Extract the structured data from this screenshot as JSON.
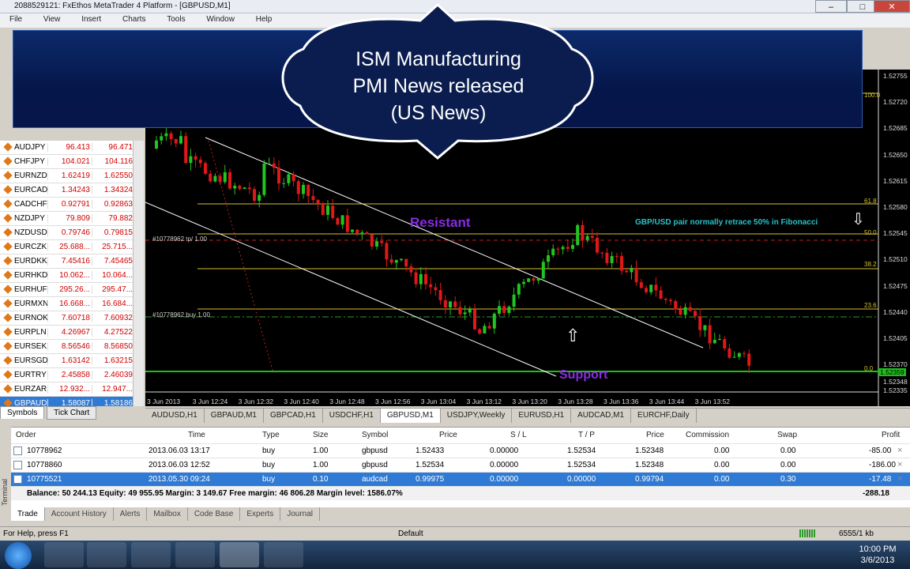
{
  "window": {
    "title": "2088529121: FxEthos MetaTrader 4 Platform - [GBPUSD,M1]"
  },
  "menu": [
    "File",
    "View",
    "Insert",
    "Charts",
    "Tools",
    "Window",
    "Help"
  ],
  "banner": {
    "line1": "ISM Manufacturing",
    "line2": "PMI News released",
    "line3": "(US News)"
  },
  "market_watch": {
    "rows": [
      {
        "symbol": "AUDJPY",
        "bid": "96.413",
        "ask": "96.471"
      },
      {
        "symbol": "CHFJPY",
        "bid": "104.021",
        "ask": "104.116"
      },
      {
        "symbol": "EURNZD",
        "bid": "1.62419",
        "ask": "1.62550"
      },
      {
        "symbol": "EURCAD",
        "bid": "1.34243",
        "ask": "1.34324"
      },
      {
        "symbol": "CADCHF",
        "bid": "0.92791",
        "ask": "0.92863"
      },
      {
        "symbol": "NZDJPY",
        "bid": "79.809",
        "ask": "79.882"
      },
      {
        "symbol": "NZDUSD",
        "bid": "0.79746",
        "ask": "0.79815"
      },
      {
        "symbol": "EURCZK",
        "bid": "25.688...",
        "ask": "25.715..."
      },
      {
        "symbol": "EURDKK",
        "bid": "7.45416",
        "ask": "7.45465"
      },
      {
        "symbol": "EURHKD",
        "bid": "10.062...",
        "ask": "10.064..."
      },
      {
        "symbol": "EURHUF",
        "bid": "295.26...",
        "ask": "295.47..."
      },
      {
        "symbol": "EURMXN",
        "bid": "16.668...",
        "ask": "16.684..."
      },
      {
        "symbol": "EURNOK",
        "bid": "7.60718",
        "ask": "7.60932"
      },
      {
        "symbol": "EURPLN",
        "bid": "4.26967",
        "ask": "4.27522"
      },
      {
        "symbol": "EURSEK",
        "bid": "8.56546",
        "ask": "8.56850"
      },
      {
        "symbol": "EURSGD",
        "bid": "1.63142",
        "ask": "1.63215"
      },
      {
        "symbol": "EURTRY",
        "bid": "2.45858",
        "ask": "2.46039"
      },
      {
        "symbol": "EURZAR",
        "bid": "12.932...",
        "ask": "12.947..."
      },
      {
        "symbol": "GBPAUD",
        "bid": "1.58087",
        "ask": "1.58186"
      }
    ],
    "tabs": [
      "Symbols",
      "Tick Chart"
    ]
  },
  "chart": {
    "resistant_label": "Resistant",
    "support_label": "Support",
    "fib_note": "GBP/USD pair normally retrace 50% in Fibonacci",
    "tp_label": "#10778962 tp/ 1.00",
    "buy_label": "#10778962 buy 1.00",
    "fib_levels": [
      "100.0",
      "61.8",
      "50.0",
      "38.2",
      "23.6",
      "0.0"
    ],
    "price_axis": [
      "1.52755",
      "1.52720",
      "1.52685",
      "1.52650",
      "1.52615",
      "1.52580",
      "1.52545",
      "1.52510",
      "1.52475",
      "1.52440",
      "1.52405",
      "1.52370",
      "1.52335"
    ],
    "current_price": "1.52359",
    "last_price": "1.52348",
    "time_axis": [
      "3 Jun 2013",
      "3 Jun 12:24",
      "3 Jun 12:32",
      "3 Jun 12:40",
      "3 Jun 12:48",
      "3 Jun 12:56",
      "3 Jun 13:04",
      "3 Jun 13:12",
      "3 Jun 13:20",
      "3 Jun 13:28",
      "3 Jun 13:36",
      "3 Jun 13:44",
      "3 Jun 13:52"
    ],
    "colors": {
      "bull": "#21c521",
      "bear": "#e01818",
      "channel": "#ffffff",
      "fib": "#d6c12f",
      "support": "#1dbf1d"
    }
  },
  "chart_tabs": [
    "AUDUSD,H1",
    "GBPAUD,M1",
    "GBPCAD,H1",
    "USDCHF,H1",
    "GBPUSD,M1",
    "USDJPY,Weekly",
    "EURUSD,H1",
    "AUDCAD,M1",
    "EURCHF,Daily"
  ],
  "chart_tab_active": "GBPUSD,M1",
  "terminal": {
    "headers": [
      "Order",
      "Time",
      "Type",
      "Size",
      "Symbol",
      "Price",
      "S / L",
      "T / P",
      "Price",
      "Commission",
      "Swap",
      "Profit"
    ],
    "rows": [
      {
        "order": "10778962",
        "time": "2013.06.03 13:17",
        "type": "buy",
        "size": "1.00",
        "symbol": "gbpusd",
        "price": "1.52433",
        "sl": "0.00000",
        "tp": "1.52534",
        "cur": "1.52348",
        "comm": "0.00",
        "swap": "0.00",
        "profit": "-85.00"
      },
      {
        "order": "10778860",
        "time": "2013.06.03 12:52",
        "type": "buy",
        "size": "1.00",
        "symbol": "gbpusd",
        "price": "1.52534",
        "sl": "0.00000",
        "tp": "1.52534",
        "cur": "1.52348",
        "comm": "0.00",
        "swap": "0.00",
        "profit": "-186.00"
      },
      {
        "order": "10775521",
        "time": "2013.05.30 09:24",
        "type": "buy",
        "size": "0.10",
        "symbol": "audcad",
        "price": "0.99975",
        "sl": "0.00000",
        "tp": "0.00000",
        "cur": "0.99794",
        "comm": "0.00",
        "swap": "0.30",
        "profit": "-17.48"
      }
    ],
    "balance_line": "Balance: 50 244.13  Equity: 49 955.95  Margin: 3 149.67  Free margin: 46 806.28  Margin level: 1586.07%",
    "total_profit": "-288.18",
    "tabs": [
      "Trade",
      "Account History",
      "Alerts",
      "Mailbox",
      "Code Base",
      "Experts",
      "Journal"
    ],
    "side_label": "Terminal"
  },
  "status": {
    "help": "For Help, press F1",
    "profile": "Default",
    "traffic": "6555/1 kb"
  },
  "taskbar": {
    "time": "10:00 PM",
    "date": "3/6/2013"
  }
}
